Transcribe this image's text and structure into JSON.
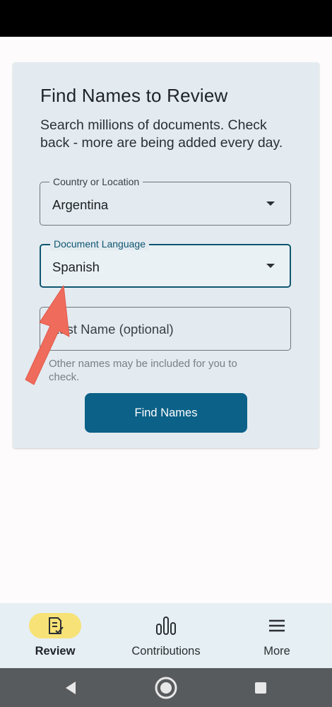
{
  "card": {
    "title": "Find Names to Review",
    "subtitle": "Search millions of documents. Check back - more are being added every day."
  },
  "country_field": {
    "label": "Country or Location",
    "value": "Argentina"
  },
  "language_field": {
    "label": "Document Language",
    "value": "Spanish"
  },
  "last_name_field": {
    "placeholder": "Last Name (optional)",
    "helper": "Other names may be included for you to check."
  },
  "find_button": {
    "label": "Find Names"
  },
  "bottom_nav": {
    "items": [
      {
        "label": "Review",
        "icon": "document-check-icon",
        "active": true
      },
      {
        "label": "Contributions",
        "icon": "bar-chart-icon",
        "active": false
      },
      {
        "label": "More",
        "icon": "menu-icon",
        "active": false
      }
    ]
  },
  "colors": {
    "accent": "#0b6188",
    "focus_border": "#0f5670",
    "card_background": "#e3ebf0",
    "active_nav_pill": "#f7e277",
    "annotation_arrow": "#ef6b5c"
  },
  "system_nav": {
    "icons": [
      "back-icon",
      "home-icon",
      "recents-icon"
    ]
  }
}
